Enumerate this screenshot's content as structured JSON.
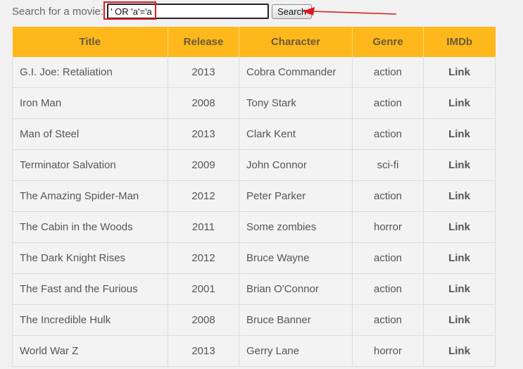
{
  "search": {
    "label": "Search for a movie:",
    "value": "' OR 'a'='a",
    "button_label": "Search"
  },
  "annotation": {
    "color": "#d81d1d"
  },
  "table": {
    "headers": [
      "Title",
      "Release",
      "Character",
      "Genre",
      "IMDb"
    ],
    "rows": [
      {
        "title": "G.I. Joe: Retaliation",
        "release": "2013",
        "character": "Cobra Commander",
        "genre": "action",
        "imdb": "Link"
      },
      {
        "title": "Iron Man",
        "release": "2008",
        "character": "Tony Stark",
        "genre": "action",
        "imdb": "Link"
      },
      {
        "title": "Man of Steel",
        "release": "2013",
        "character": "Clark Kent",
        "genre": "action",
        "imdb": "Link"
      },
      {
        "title": "Terminator Salvation",
        "release": "2009",
        "character": "John Connor",
        "genre": "sci-fi",
        "imdb": "Link"
      },
      {
        "title": "The Amazing Spider-Man",
        "release": "2012",
        "character": "Peter Parker",
        "genre": "action",
        "imdb": "Link"
      },
      {
        "title": "The Cabin in the Woods",
        "release": "2011",
        "character": "Some zombies",
        "genre": "horror",
        "imdb": "Link"
      },
      {
        "title": "The Dark Knight Rises",
        "release": "2012",
        "character": "Bruce Wayne",
        "genre": "action",
        "imdb": "Link"
      },
      {
        "title": "The Fast and the Furious",
        "release": "2001",
        "character": "Brian O'Connor",
        "genre": "action",
        "imdb": "Link"
      },
      {
        "title": "The Incredible Hulk",
        "release": "2008",
        "character": "Bruce Banner",
        "genre": "action",
        "imdb": "Link"
      },
      {
        "title": "World War Z",
        "release": "2013",
        "character": "Gerry Lane",
        "genre": "horror",
        "imdb": "Link"
      }
    ]
  },
  "theme": {
    "header_bg": "#ffb81c",
    "page_bg": "#f1f1f1"
  }
}
